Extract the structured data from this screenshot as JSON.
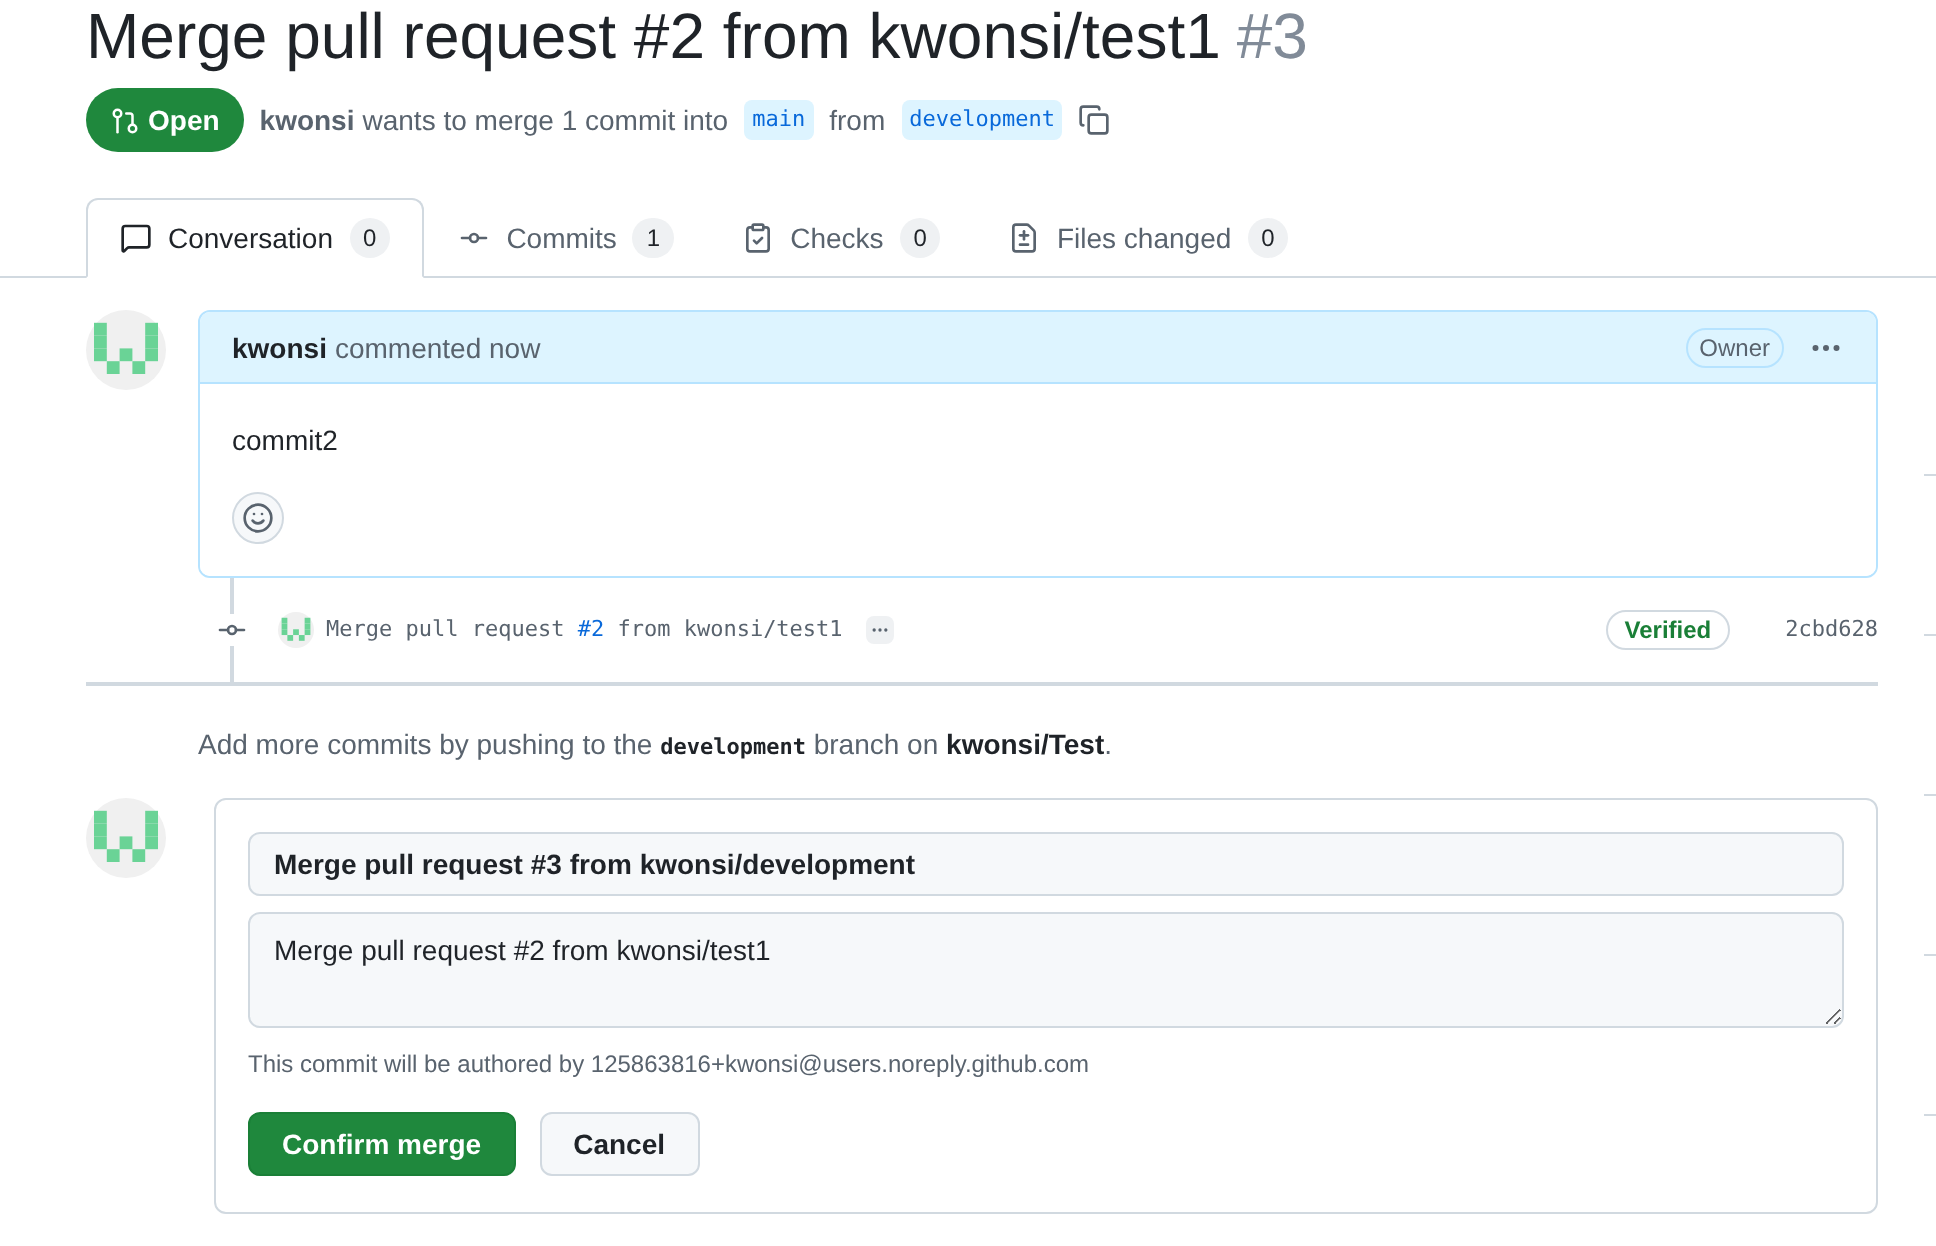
{
  "title": {
    "text": "Merge pull request #2 from kwonsi/test1",
    "number": "#3"
  },
  "state": {
    "label": "Open",
    "kind": "open"
  },
  "summary": {
    "author": "kwonsi",
    "text": "wants to merge 1 commit into",
    "base": "main",
    "from": "from",
    "head": "development"
  },
  "tabs": [
    {
      "label": "Conversation",
      "count": "0",
      "selected": true,
      "kind": "conversation"
    },
    {
      "label": "Commits",
      "count": "1",
      "selected": false,
      "kind": "commits"
    },
    {
      "label": "Checks",
      "count": "0",
      "selected": false,
      "kind": "checks"
    },
    {
      "label": "Files changed",
      "count": "0",
      "selected": false,
      "kind": "files"
    }
  ],
  "comment": {
    "author": "kwonsi",
    "action": "commented now",
    "role": "Owner",
    "body": "commit2"
  },
  "commit": {
    "before": "Merge pull request ",
    "link": "#2",
    "after": " from kwonsi/test1",
    "badge": "Verified",
    "sha": "2cbd628"
  },
  "hint": [
    {
      "kind": "text",
      "text": "Add more commits by pushing to the "
    },
    {
      "kind": "code",
      "text": "development"
    },
    {
      "kind": "text",
      "text": " branch on "
    },
    {
      "kind": "bold",
      "text": "kwonsi/Test"
    },
    {
      "kind": "text",
      "text": "."
    }
  ],
  "merge": {
    "title_value": "Merge pull request #3 from kwonsi/development",
    "body_value": "Merge pull request #2 from kwonsi/test1",
    "note": "This commit will be authored by 125863816+kwonsi@users.noreply.github.com",
    "confirm": "Confirm merge",
    "cancel": "Cancel"
  }
}
